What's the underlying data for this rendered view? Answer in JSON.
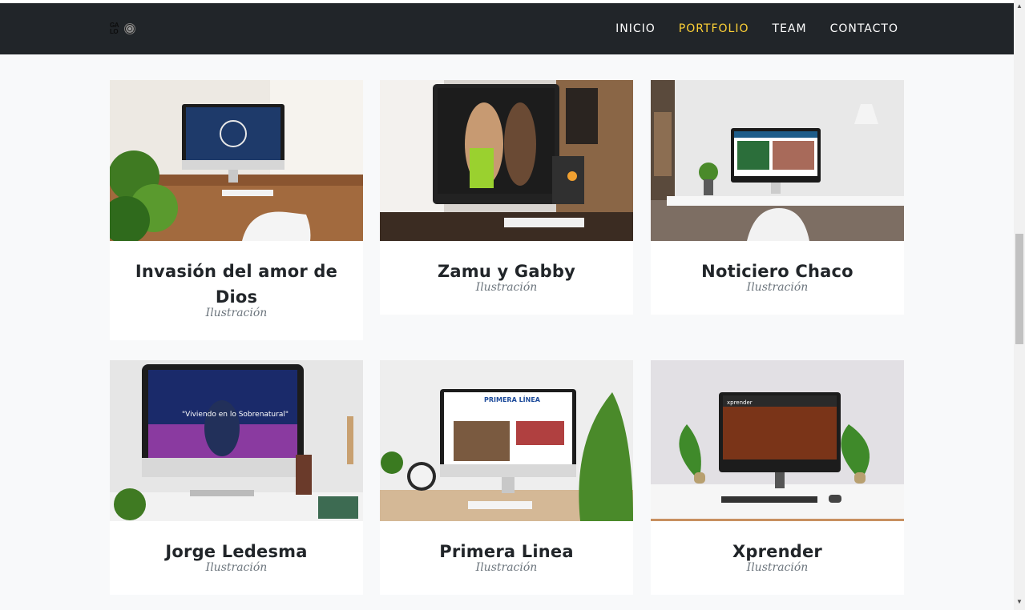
{
  "logo": {
    "text": "GA LO"
  },
  "nav": {
    "items": [
      {
        "label": "INICIO",
        "active": false
      },
      {
        "label": "PORTFOLIO",
        "active": true
      },
      {
        "label": "TEAM",
        "active": false
      },
      {
        "label": "CONTACTO",
        "active": false
      }
    ]
  },
  "portfolio": {
    "items": [
      {
        "title": "Invasión del amor de Dios",
        "category": "Ilustración"
      },
      {
        "title": "Zamu y Gabby",
        "category": "Ilustración"
      },
      {
        "title": "Noticiero Chaco",
        "category": "Ilustración"
      },
      {
        "title": "Jorge Ledesma",
        "category": "Ilustración"
      },
      {
        "title": "Primera Linea",
        "category": "Ilustración"
      },
      {
        "title": "Xprender",
        "category": "Ilustración"
      }
    ],
    "screens": {
      "jorge_quote": "\"Viviendo en lo Sobrenatural\"",
      "primera_brand": "PRIMERA LÍNEA",
      "xprender_brand": "xprender"
    }
  },
  "colors": {
    "navbar": "#212529",
    "accent": "#fed136",
    "page_bg": "#f8f9fa"
  }
}
